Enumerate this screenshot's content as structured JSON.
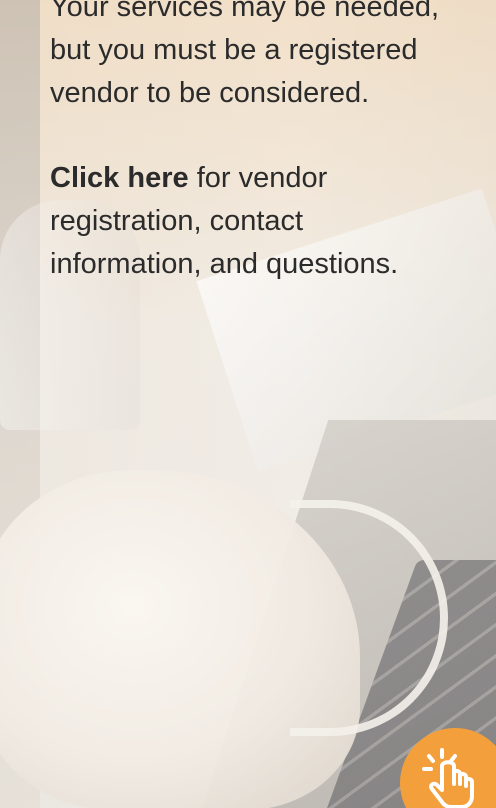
{
  "banner": {
    "paragraph1": "Your services may be needed, but you must be a registered vendor to be considered.",
    "link_text": "Click here",
    "paragraph2_rest": " for vendor registration, contact information, and questions."
  },
  "icons": {
    "tap": "hand-pointer-tap-icon"
  },
  "colors": {
    "accent": "#f3a03c",
    "text": "#2b2b2b"
  }
}
